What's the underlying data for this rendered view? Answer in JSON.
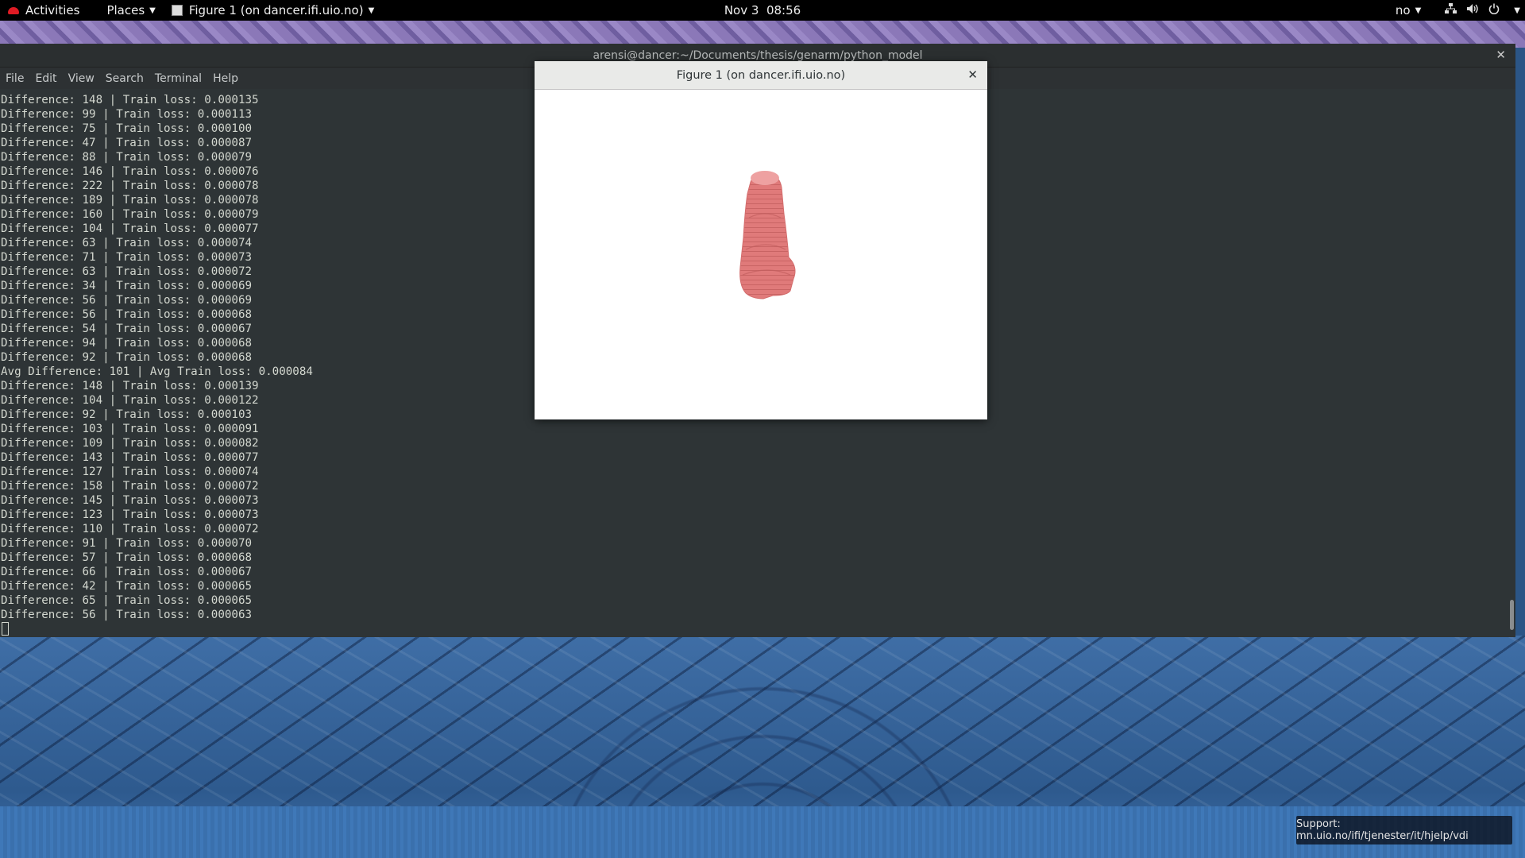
{
  "topbar": {
    "activities": "Activities",
    "places": "Places",
    "app_menu": "Figure 1 (on dancer.ifi.uio.no)",
    "clock": "Nov 3  08:56",
    "keyboard_layout": "no"
  },
  "terminal": {
    "title": "arensi@dancer:~/Documents/thesis/genarm/python_model",
    "menu": [
      "File",
      "Edit",
      "View",
      "Search",
      "Terminal",
      "Help"
    ],
    "lines": [
      "Difference: 148 | Train loss: 0.000135",
      "Difference: 99 | Train loss: 0.000113",
      "Difference: 75 | Train loss: 0.000100",
      "Difference: 47 | Train loss: 0.000087",
      "Difference: 88 | Train loss: 0.000079",
      "Difference: 146 | Train loss: 0.000076",
      "Difference: 222 | Train loss: 0.000078",
      "Difference: 189 | Train loss: 0.000078",
      "Difference: 160 | Train loss: 0.000079",
      "Difference: 104 | Train loss: 0.000077",
      "Difference: 63 | Train loss: 0.000074",
      "Difference: 71 | Train loss: 0.000073",
      "Difference: 63 | Train loss: 0.000072",
      "Difference: 34 | Train loss: 0.000069",
      "Difference: 56 | Train loss: 0.000069",
      "Difference: 56 | Train loss: 0.000068",
      "Difference: 54 | Train loss: 0.000067",
      "Difference: 94 | Train loss: 0.000068",
      "Difference: 92 | Train loss: 0.000068",
      "Avg Difference: 101 | Avg Train loss: 0.000084",
      "Difference: 148 | Train loss: 0.000139",
      "Difference: 104 | Train loss: 0.000122",
      "Difference: 92 | Train loss: 0.000103",
      "Difference: 103 | Train loss: 0.000091",
      "Difference: 109 | Train loss: 0.000082",
      "Difference: 143 | Train loss: 0.000077",
      "Difference: 127 | Train loss: 0.000074",
      "Difference: 158 | Train loss: 0.000072",
      "Difference: 145 | Train loss: 0.000073",
      "Difference: 123 | Train loss: 0.000073",
      "Difference: 110 | Train loss: 0.000072",
      "Difference: 91 | Train loss: 0.000070",
      "Difference: 57 | Train loss: 0.000068",
      "Difference: 66 | Train loss: 0.000067",
      "Difference: 42 | Train loss: 0.000065",
      "Difference: 65 | Train loss: 0.000065",
      "Difference: 56 | Train loss: 0.000063"
    ]
  },
  "figure": {
    "title": "Figure 1 (on dancer.ifi.uio.no)",
    "object_color": "#e07a7a"
  },
  "support": "Support: mn.uio.no/ifi/tjenester/it/hjelp/vdi",
  "icons": {
    "close": "close-icon",
    "network": "network-icon",
    "volume": "volume-icon",
    "power": "power-icon"
  }
}
